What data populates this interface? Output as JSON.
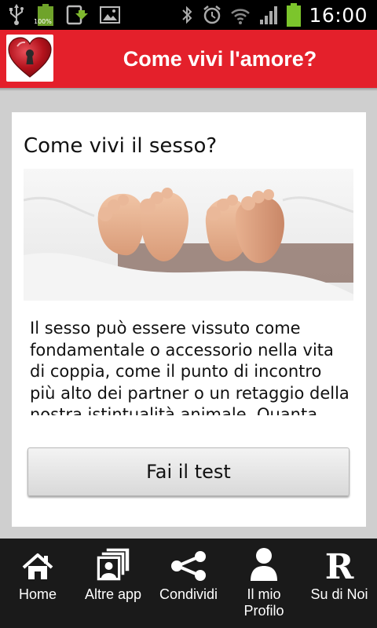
{
  "status_bar": {
    "time": "16:00",
    "battery_percent_label": "100%",
    "icons": [
      "usb-icon",
      "battery-full-icon",
      "file-upload-icon",
      "picture-icon",
      "bluetooth-icon",
      "alarm-icon",
      "wifi-icon",
      "signal-icon",
      "battery-charging-icon"
    ]
  },
  "header": {
    "title": "Come vivi l'amore?",
    "logo_icon": "heart-keyhole-icon",
    "color": "#e4202b"
  },
  "card": {
    "title": "Come vivi il sesso?",
    "image_icon": "feet-under-sheets-image",
    "text": "Il sesso può essere vissuto come fondamentale o accessorio nella vita di coppia, come il punto di incontro più alto dei partner o un retaggio della nostra istintualità animale. Quanta",
    "button_label": "Fai il test"
  },
  "bottom_nav": {
    "items": [
      {
        "label": "Home",
        "icon": "home-icon"
      },
      {
        "label": "Altre app",
        "icon": "apps-stack-icon"
      },
      {
        "label": "Condividi",
        "icon": "share-icon"
      },
      {
        "label": "Il mio Profilo",
        "icon": "profile-icon"
      },
      {
        "label": "Su di Noi",
        "icon": "about-r-icon"
      }
    ]
  }
}
